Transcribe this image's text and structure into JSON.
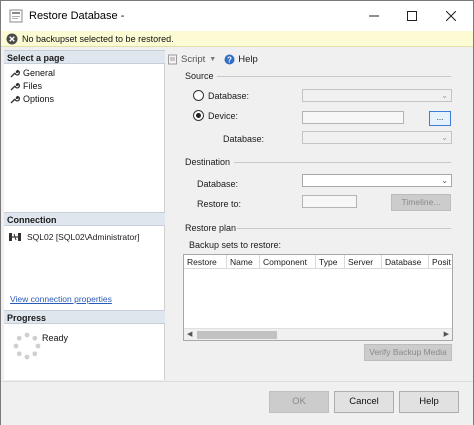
{
  "window": {
    "title": "Restore Database -"
  },
  "infobar": {
    "message": "No backupset selected to be restored."
  },
  "left": {
    "select_page_header": "Select a page",
    "pages": [
      {
        "label": "General"
      },
      {
        "label": "Files"
      },
      {
        "label": "Options"
      }
    ],
    "connection_header": "Connection",
    "connection_text": "SQL02 [SQL02\\Administrator]",
    "connection_link": "View connection properties",
    "progress_header": "Progress",
    "progress_status": "Ready"
  },
  "toolbar": {
    "script_label": "Script",
    "help_label": "Help"
  },
  "source": {
    "group_label": "Source",
    "database_option": "Database:",
    "device_option": "Device:",
    "browse_label": "...",
    "database_label": "Database:",
    "selected_option": "Device"
  },
  "destination": {
    "group_label": "Destination",
    "database_label": "Database:",
    "restore_to_label": "Restore to:",
    "timeline_label": "Timeline..."
  },
  "restore_plan": {
    "group_label": "Restore plan",
    "backup_sets_label": "Backup sets to restore:",
    "columns": [
      "Restore",
      "Name",
      "Component",
      "Type",
      "Server",
      "Database",
      "Posit"
    ],
    "verify_label": "Verify Backup Media"
  },
  "footer": {
    "ok_label": "OK",
    "cancel_label": "Cancel",
    "help_label": "Help"
  },
  "colors": {
    "infobar_bg": "#fdfbd4",
    "section_header_bg": "#dfe6ee",
    "link": "#2a5ab8",
    "focus_border": "#3c7fd9"
  }
}
